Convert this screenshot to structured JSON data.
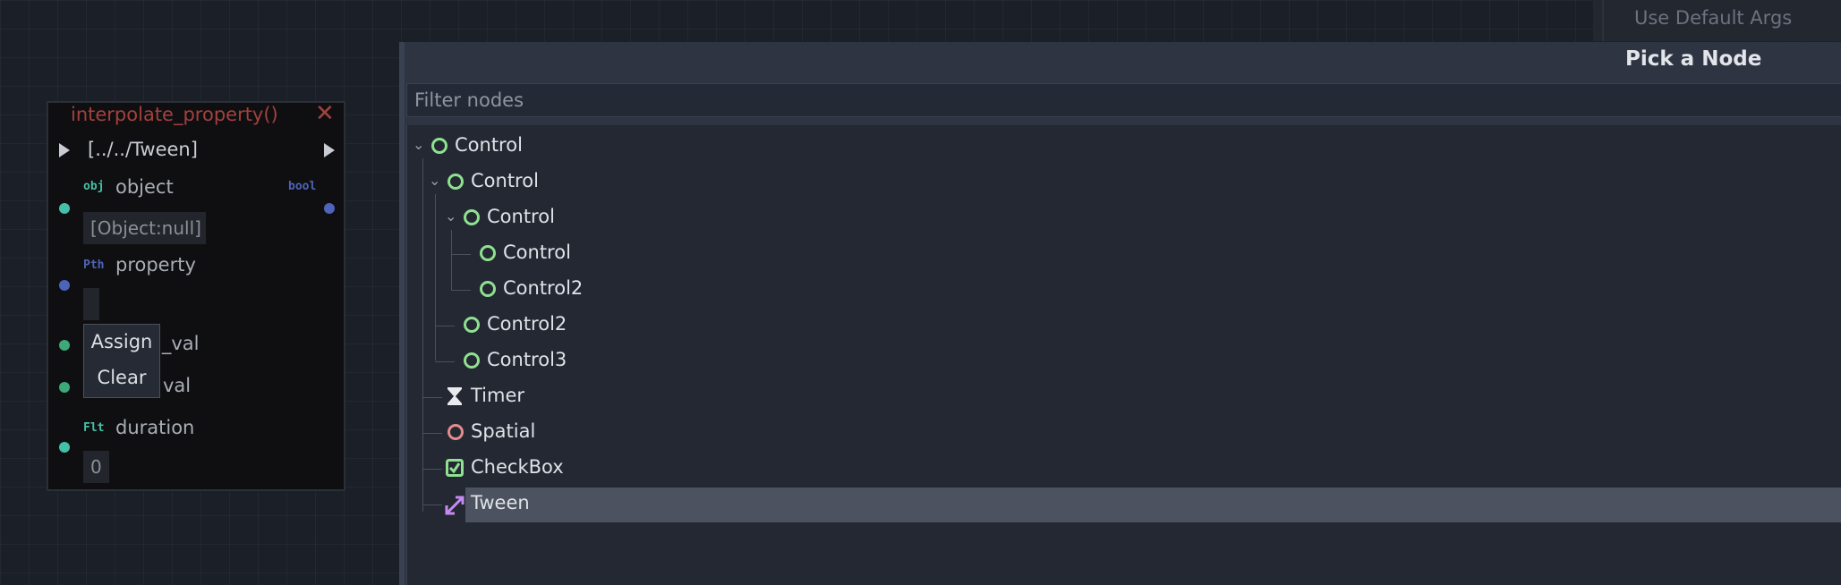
{
  "top_bar": {
    "use_default_args": "Use Default Args"
  },
  "node": {
    "title": "interpolate_property()",
    "close_glyph": "✕",
    "target_path": "[../../Tween]",
    "ports": [
      {
        "type_tag": "obj",
        "label": "object",
        "value": "[Object:null]",
        "color": "#44c0a8"
      },
      {
        "type_tag": "Pth",
        "label": "property",
        "value": "",
        "color": "#4d64b8"
      },
      {
        "type_tag": "",
        "label": "initial_val",
        "visible_label": "l_val",
        "color": "#3ea87a"
      },
      {
        "type_tag": "",
        "label": "final_val",
        "visible_label": "val",
        "color": "#3ea87a"
      },
      {
        "type_tag": "Flt",
        "label": "duration",
        "value": "0",
        "color": "#44c0a8"
      }
    ],
    "return_tag": "bool",
    "return_color": "#4d64b8"
  },
  "context_menu": {
    "items": [
      "Assign",
      "Clear"
    ]
  },
  "dialog": {
    "title": "Pick a Node",
    "filter_placeholder": "Filter nodes",
    "tree": [
      {
        "label": "Control",
        "icon": "control-ring-icon"
      },
      {
        "label": "Control",
        "icon": "control-ring-icon"
      },
      {
        "label": "Control",
        "icon": "control-ring-icon"
      },
      {
        "label": "Control",
        "icon": "control-ring-icon"
      },
      {
        "label": "Control2",
        "icon": "control-ring-icon"
      },
      {
        "label": "Control2",
        "icon": "control-ring-icon"
      },
      {
        "label": "Control3",
        "icon": "control-ring-icon"
      },
      {
        "label": "Timer",
        "icon": "hourglass-icon"
      },
      {
        "label": "Spatial",
        "icon": "spatial-ring-icon"
      },
      {
        "label": "CheckBox",
        "icon": "checkbox-icon"
      },
      {
        "label": "Tween",
        "icon": "tween-icon",
        "selected": true
      }
    ]
  },
  "colors": {
    "accent_green": "#8fe08f",
    "spatial_red": "#e38c8c",
    "tween_purple": "#c58af2",
    "title_red": "#a3413e"
  }
}
